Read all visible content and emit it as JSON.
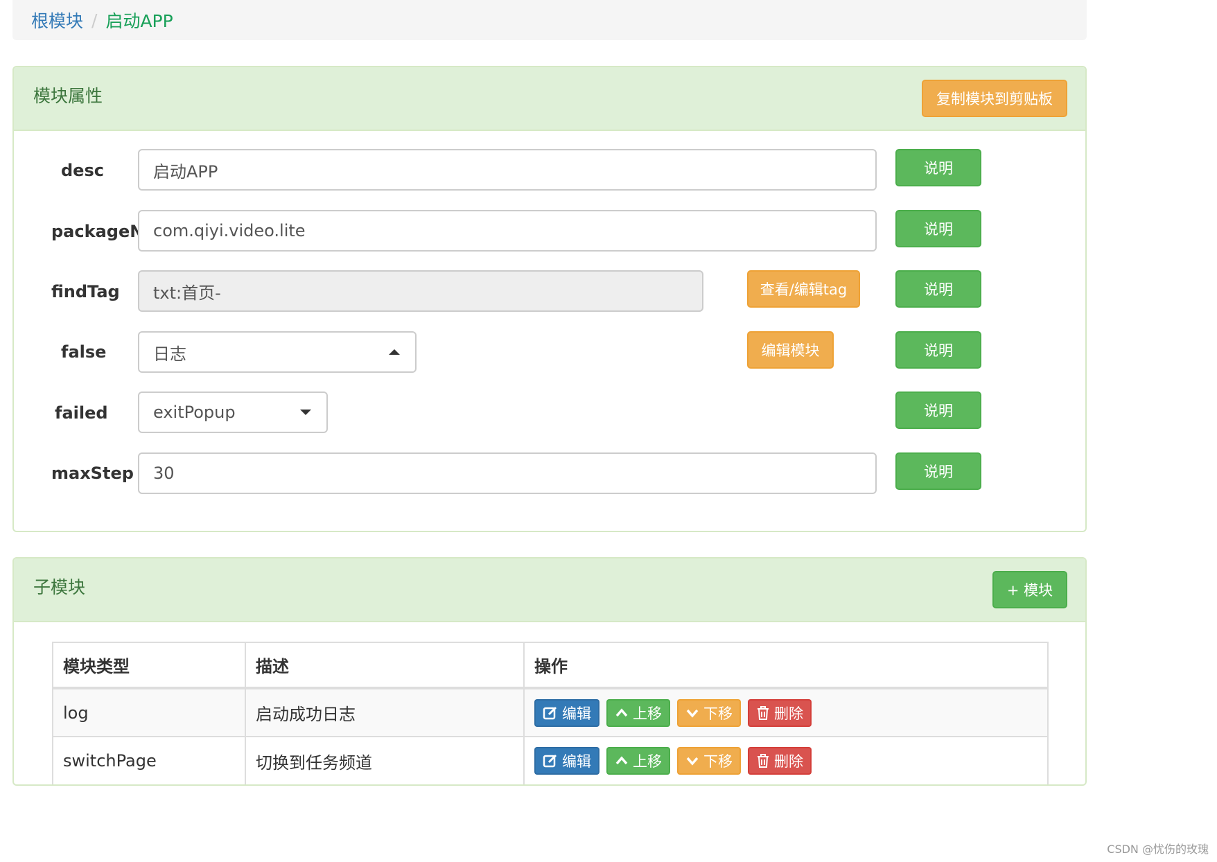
{
  "breadcrumb": {
    "root": "根模块",
    "separator": "/",
    "current": "启动APP"
  },
  "attributes_panel": {
    "title": "模块属性",
    "copy_button": "复制模块到剪贴板",
    "help_label": "说明",
    "fields": {
      "desc": {
        "label": "desc",
        "value": "启动APP"
      },
      "packageName": {
        "label": "packageName",
        "value": "com.qiyi.video.lite"
      },
      "findTag": {
        "label": "findTag",
        "value": "txt:首页-",
        "edit_button": "查看/编辑tag"
      },
      "false": {
        "label": "false",
        "value": "日志",
        "edit_button": "编辑模块"
      },
      "failed": {
        "label": "failed",
        "value": "exitPopup"
      },
      "maxStep": {
        "label": "maxStep",
        "value": "30"
      }
    }
  },
  "submodules_panel": {
    "title": "子模块",
    "add_button": "+ 模块",
    "columns": [
      "模块类型",
      "描述",
      "操作"
    ],
    "actions": {
      "edit": "编辑",
      "up": "上移",
      "down": "下移",
      "delete": "删除"
    },
    "rows": [
      {
        "type": "log",
        "desc": "启动成功日志"
      },
      {
        "type": "switchPage",
        "desc": "切换到任务频道"
      }
    ]
  },
  "watermark": "CSDN @忧伤的玫瑰",
  "icons": [
    "edit-icon",
    "chevron-up-icon",
    "chevron-down-icon",
    "trash-icon",
    "caret-up-icon",
    "caret-down-icon"
  ],
  "colors": {
    "success": "#5cb85c",
    "warning": "#f0ad4e",
    "primary": "#337ab7",
    "danger": "#d9534f",
    "panel_heading": "#dff0d8",
    "panel_title": "#3c763d"
  }
}
